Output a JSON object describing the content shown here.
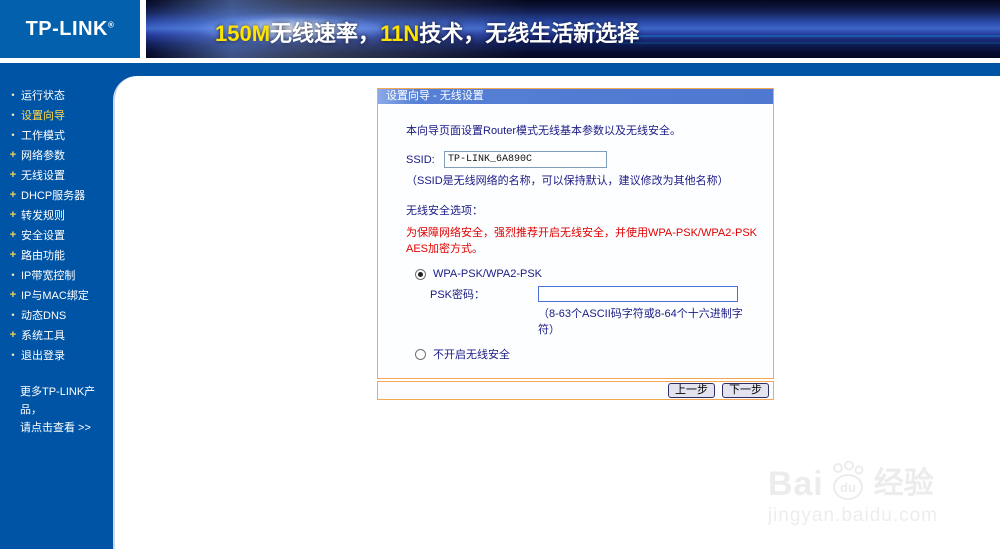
{
  "header": {
    "logo_text": "TP-LINK",
    "logo_reg": "®",
    "banner": {
      "seg1": "150M",
      "seg2": "无线速率，",
      "seg3": "11N",
      "seg4": "技术，无线生活新选择"
    }
  },
  "sidebar": {
    "items": [
      {
        "bullet": "•",
        "label": "运行状态",
        "active": false
      },
      {
        "bullet": "•",
        "label": "设置向导",
        "active": true
      },
      {
        "bullet": "•",
        "label": "工作模式",
        "active": false
      },
      {
        "bullet": "+",
        "label": "网络参数",
        "active": false
      },
      {
        "bullet": "+",
        "label": "无线设置",
        "active": false
      },
      {
        "bullet": "+",
        "label": "DHCP服务器",
        "active": false
      },
      {
        "bullet": "+",
        "label": "转发规则",
        "active": false
      },
      {
        "bullet": "+",
        "label": "安全设置",
        "active": false
      },
      {
        "bullet": "+",
        "label": "路由功能",
        "active": false
      },
      {
        "bullet": "•",
        "label": "IP带宽控制",
        "active": false
      },
      {
        "bullet": "+",
        "label": "IP与MAC绑定",
        "active": false
      },
      {
        "bullet": "•",
        "label": "动态DNS",
        "active": false
      },
      {
        "bullet": "+",
        "label": "系统工具",
        "active": false
      },
      {
        "bullet": "•",
        "label": "退出登录",
        "active": false
      }
    ],
    "more_line1": "更多TP-LINK产品，",
    "more_line2": "请点击查看 >>"
  },
  "wizard": {
    "title": "设置向导 - 无线设置",
    "intro": "本向导页面设置Router模式无线基本参数以及无线安全。",
    "ssid_label": "SSID:",
    "ssid_value": "TP-LINK_6A890C",
    "ssid_hint": "（SSID是无线网络的名称，可以保持默认，建议修改为其他名称）",
    "security_label": "无线安全选项：",
    "security_warning": "为保障网络安全，强烈推荐开启无线安全，并使用WPA-PSK/WPA2-PSK AES加密方式。",
    "option1_label": "WPA-PSK/WPA2-PSK",
    "option1_selected": true,
    "psk_label": "PSK密码：",
    "psk_value": "",
    "psk_hint": "（8-63个ASCII码字符或8-64个十六进制字符）",
    "option2_label": "不开启无线安全",
    "option2_selected": false,
    "back_button": "上一步",
    "next_button": "下一步"
  },
  "watermark": {
    "brand_left": "Bai",
    "paw_text": "du",
    "suffix": "经验",
    "domain": "jingyan.baidu.com"
  },
  "colors": {
    "sidebar_blue": "#0054A6",
    "logo_blue": "#0260AC",
    "dialog_border": "#F2A854",
    "title_bar_blue": "#5580D5",
    "warning_red": "#E00000",
    "banner_highlight": "#FFE400",
    "active_menu_item": "#FFD84D"
  }
}
